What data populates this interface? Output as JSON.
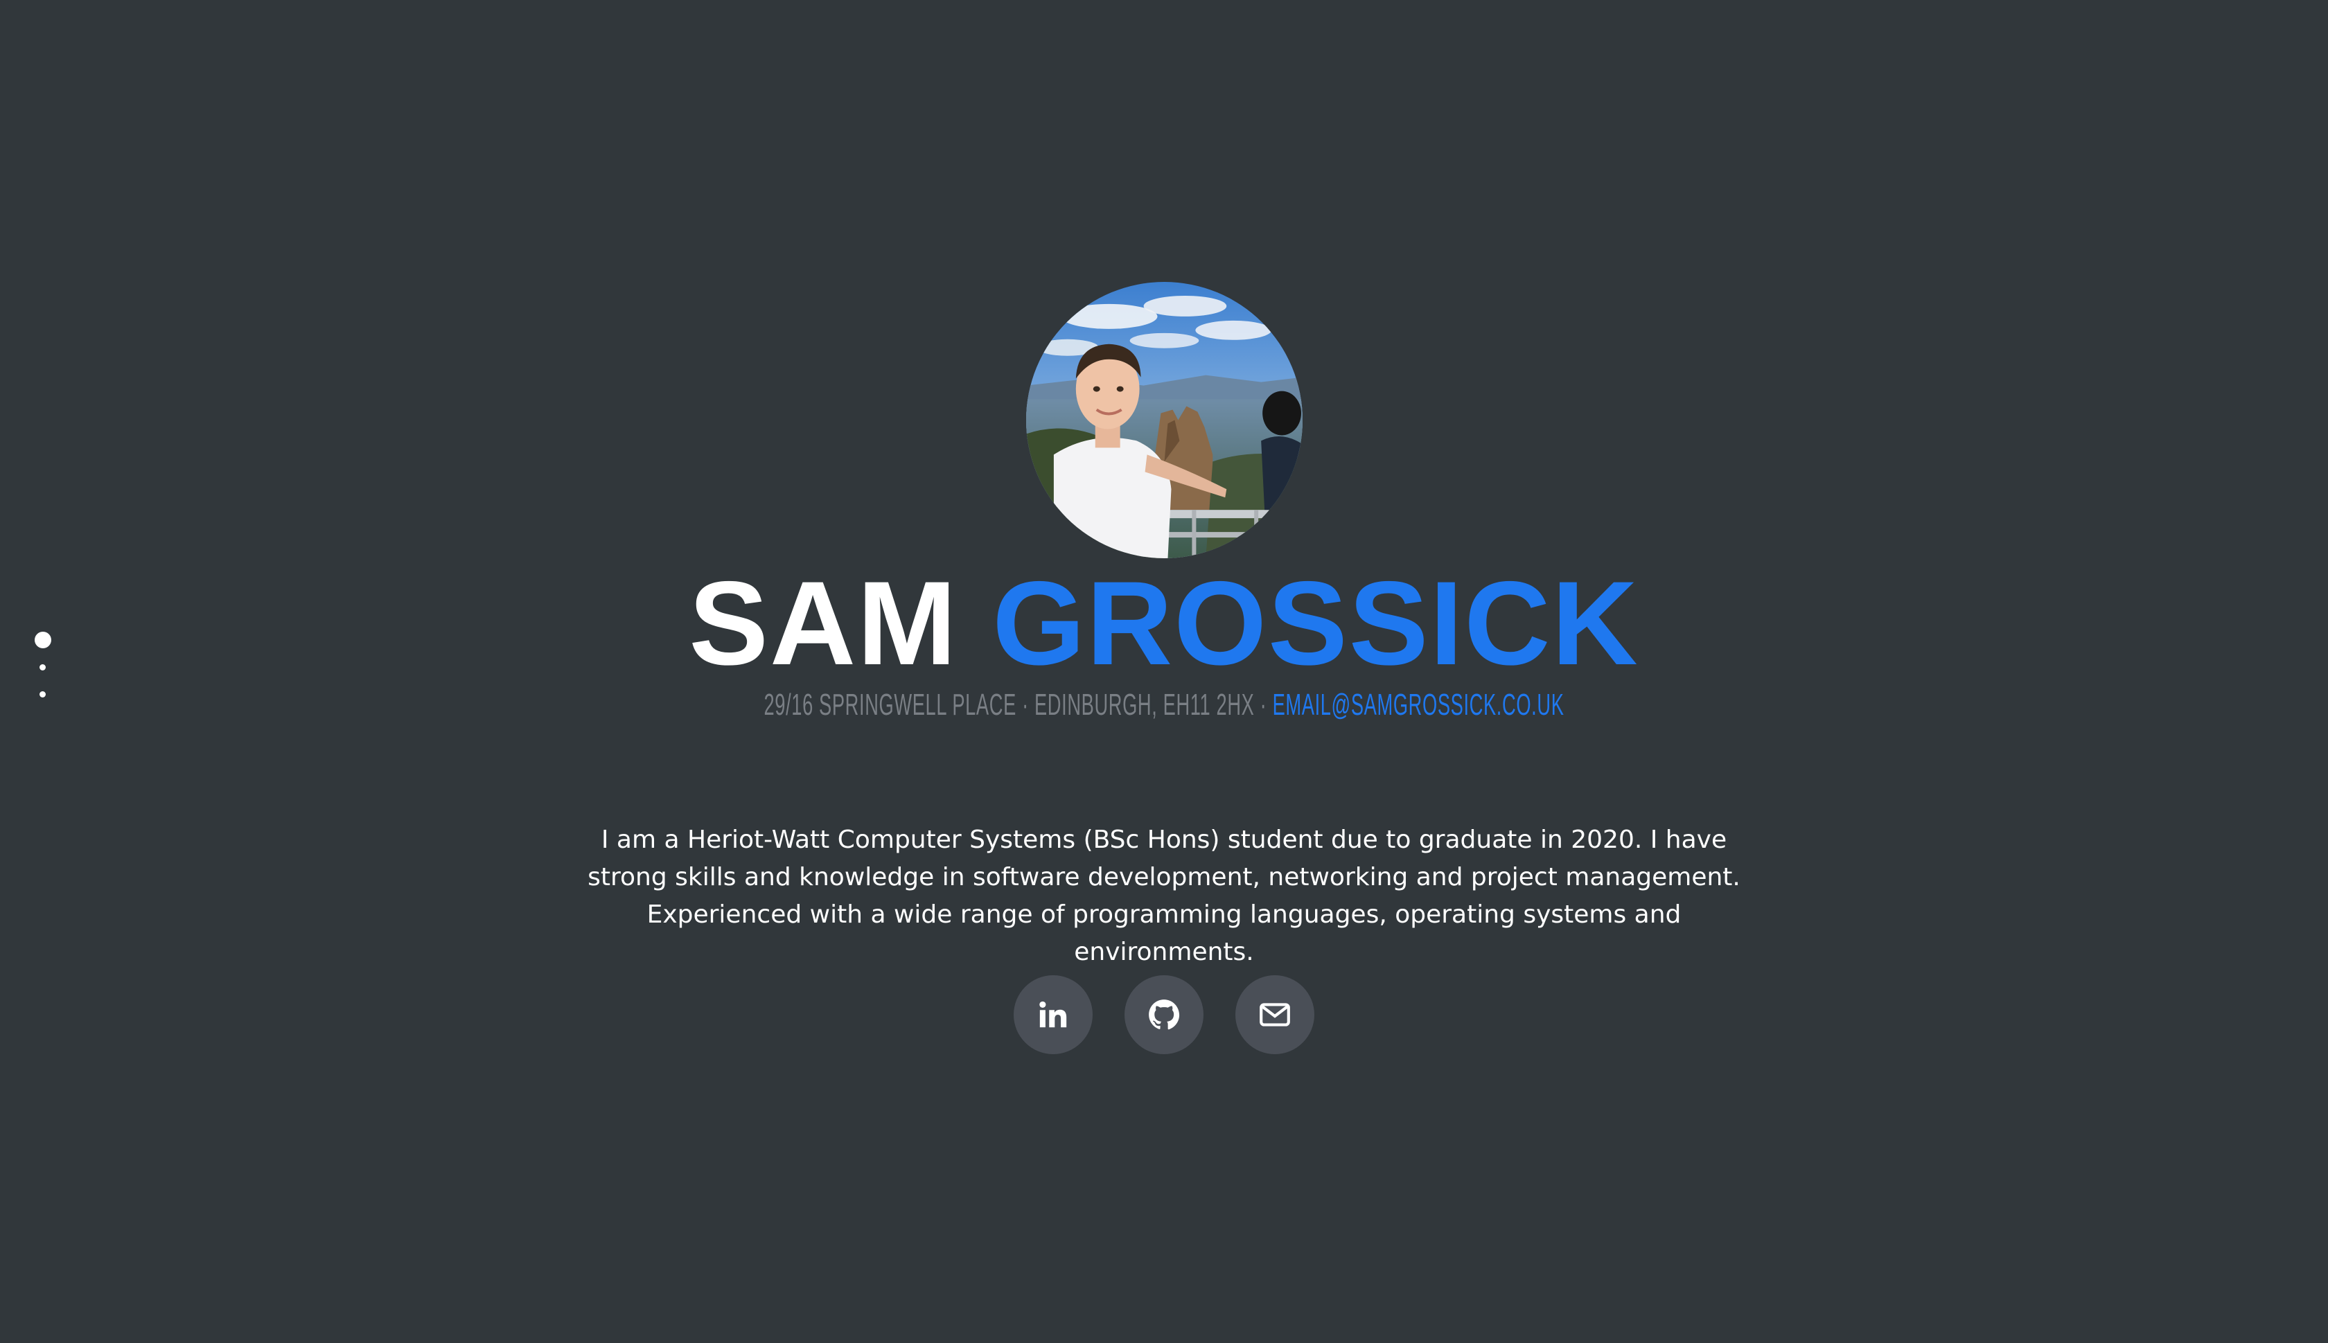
{
  "nav": {
    "dots": [
      "section-1",
      "section-2",
      "section-3"
    ],
    "active_index": 0
  },
  "profile": {
    "avatar_icon": "profile-photo",
    "first_name": "SAM",
    "last_name": "GROSSICK",
    "address": "29/16 Springwell Place · Edinburgh, EH11 2HX ·",
    "email": "email@samgrossick.co.uk",
    "bio": "I am a Heriot-Watt Computer Systems (BSc Hons) student due to graduate in 2020. I have strong skills and knowledge in software development, networking and project management. Experienced with a wide range of programming languages, operating systems and environments."
  },
  "socials": [
    {
      "name": "linkedin",
      "icon": "linkedin-icon"
    },
    {
      "name": "github",
      "icon": "github-icon"
    },
    {
      "name": "email",
      "icon": "mail-icon"
    }
  ],
  "colors": {
    "background": "#31373b",
    "accent": "#1f78ef",
    "button": "#4a4f57",
    "muted": "#7a7f85"
  }
}
